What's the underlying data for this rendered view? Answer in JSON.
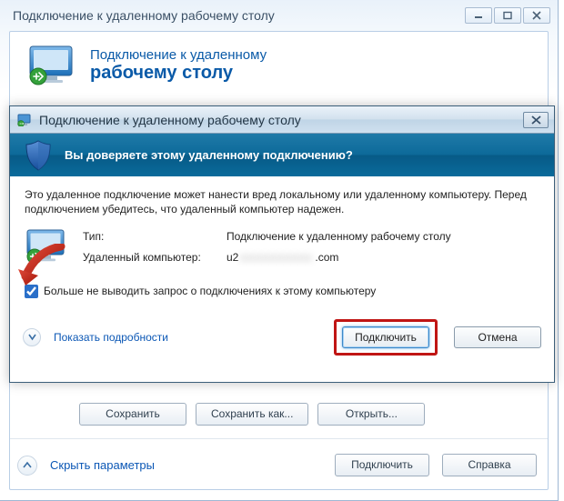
{
  "parent_window": {
    "title": "Подключение к удаленному рабочему столу",
    "header_line1": "Подключение к удаленному",
    "header_line2": "рабочему столу",
    "save": "Сохранить",
    "save_as": "Сохранить как...",
    "open": "Открыть...",
    "collapse": "Скрыть параметры",
    "connect": "Подключить",
    "help": "Справка"
  },
  "dialog": {
    "title": "Подключение к удаленному рабочему столу",
    "band": "Вы доверяете этому удаленному подключению?",
    "warning": "Это удаленное подключение может нанести вред локальному или удаленному компьютеру. Перед подключением убедитесь, что удаленный компьютер надежен.",
    "type_label": "Тип:",
    "type_value": "Подключение к удаленному рабочему столу",
    "computer_label": "Удаленный компьютер:",
    "computer_prefix": "u2",
    "computer_obscured": "xxxxxxxxxx",
    "computer_suffix": ".com",
    "checkbox_label": "Больше не выводить запрос о подключениях к этому компьютеру",
    "checkbox_checked": true,
    "show_details": "Показать подробности",
    "connect": "Подключить",
    "cancel": "Отмена"
  },
  "icons": {
    "monitor": "rdc-monitor-icon",
    "shield": "shield-icon",
    "minimize": "minimize-icon",
    "maximize": "maximize-icon",
    "close": "close-icon",
    "chevron_down": "chevron-down-icon",
    "chevron_up": "chevron-up-icon"
  },
  "colors": {
    "accent_blue": "#0a5aa8",
    "band_teal": "#0d6a9a",
    "highlight_red": "#c01514"
  }
}
